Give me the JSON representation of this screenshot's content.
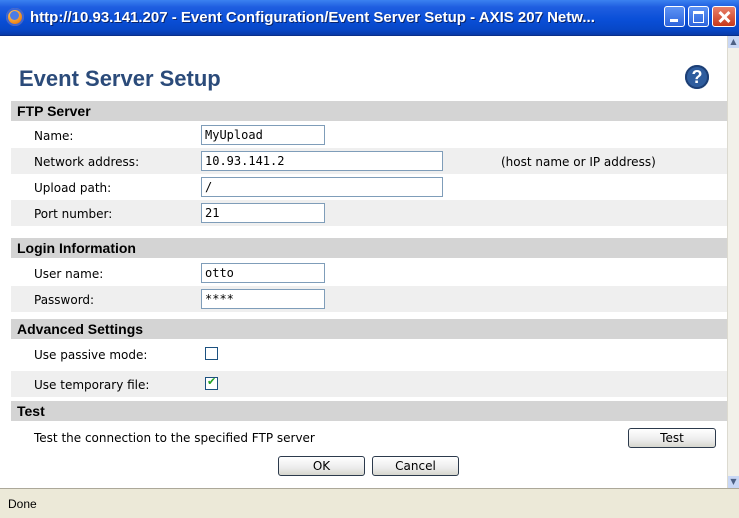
{
  "window": {
    "title": "http://10.93.141.207 - Event Configuration/Event Server Setup - AXIS 207 Netw..."
  },
  "page": {
    "title": "Event Server Setup",
    "help_glyph": "?"
  },
  "sections": {
    "ftp_server": {
      "title": "FTP Server",
      "name_label": "Name:",
      "name_value": "MyUpload",
      "address_label": "Network address:",
      "address_value": "10.93.141.2",
      "address_hint": "(host name or IP address)",
      "path_label": "Upload path:",
      "path_value": "/",
      "port_label": "Port number:",
      "port_value": "21"
    },
    "login": {
      "title": "Login Information",
      "user_label": "User name:",
      "user_value": "otto",
      "password_label": "Password:",
      "password_value": "****"
    },
    "advanced": {
      "title": "Advanced Settings",
      "passive_label": "Use passive mode:",
      "passive_checked": false,
      "temp_label": "Use temporary file:",
      "temp_checked": true,
      "check_glyph": "✔"
    },
    "test": {
      "title": "Test",
      "description": "Test the connection to the specified FTP server",
      "button_label": "Test"
    }
  },
  "actions": {
    "ok_label": "OK",
    "cancel_label": "Cancel"
  },
  "status": {
    "text": "Done"
  }
}
